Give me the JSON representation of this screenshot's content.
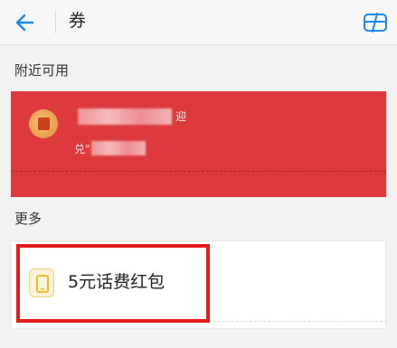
{
  "header": {
    "title": "券",
    "back_icon": "arrow-left-icon",
    "card_icon": "card-icon",
    "accent": "#1e88e5"
  },
  "sections": {
    "nearby_label": "附近可用",
    "more_label": "更多"
  },
  "nearby_coupon": {
    "text_fragment_1": "迎",
    "text_fragment_2": "兑\"",
    "background": "#de3a3d"
  },
  "more_coupon": {
    "label": "5元话费红包",
    "icon": "phone-icon",
    "icon_color": "#f0b92e"
  },
  "highlight_color": "#e41c1c"
}
